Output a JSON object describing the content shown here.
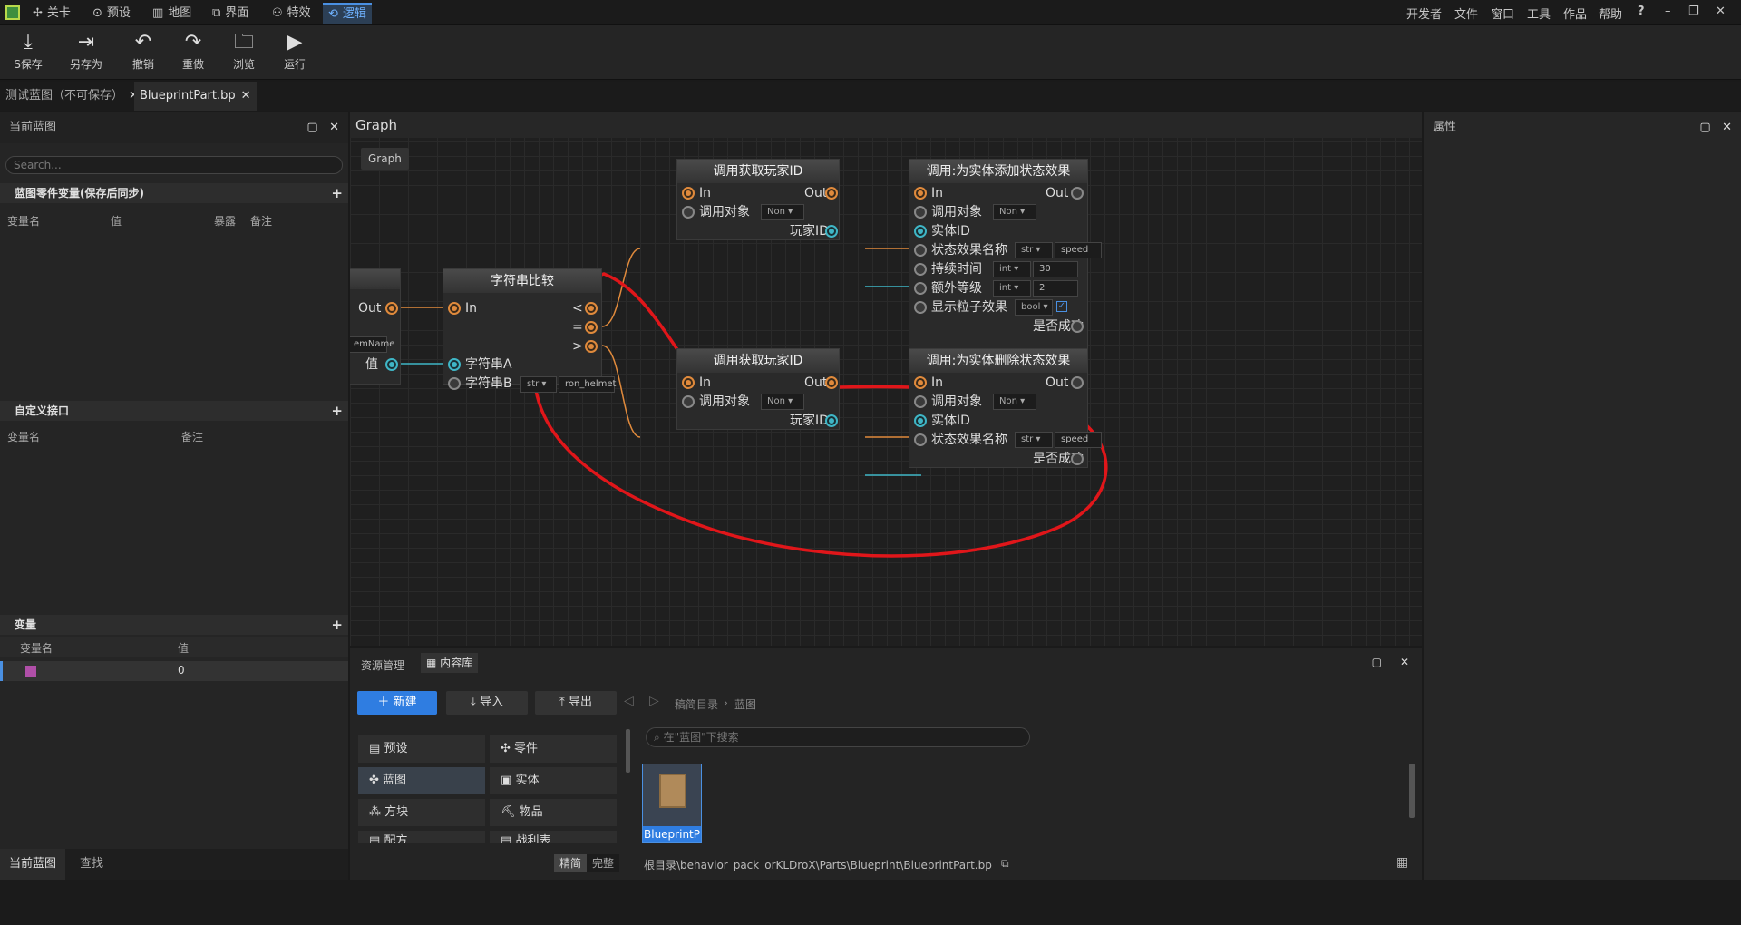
{
  "menu": {
    "tabs": [
      "关卡",
      "预设",
      "地图",
      "界面",
      "特效",
      "逻辑"
    ],
    "right": [
      "开发者",
      "文件",
      "窗口",
      "工具",
      "作品",
      "帮助",
      "?"
    ]
  },
  "toolbar": {
    "save": "S保存",
    "saveas": "另存为",
    "undo": "撤销",
    "redo": "重做",
    "browse": "浏览",
    "run": "运行"
  },
  "doc_tabs": [
    "测试蓝图（不可保存）",
    "BlueprintPart.bp"
  ],
  "left": {
    "title": "当前蓝图",
    "search_placeholder": "Search...",
    "sec1": "蓝图零件变量(保存后同步)",
    "sec1_cols": [
      "变量名",
      "值",
      "暴露",
      "备注"
    ],
    "sec2": "自定义接口",
    "sec2_cols": [
      "变量名",
      "备注"
    ],
    "sec3": "变量",
    "sec3_cols": [
      "变量名",
      "值"
    ],
    "var_value": "0",
    "bottom_tabs": [
      "当前蓝图",
      "查找"
    ]
  },
  "graph": {
    "title": "Graph",
    "crumb": "Graph",
    "partial": {
      "out": "Out",
      "field": "emName",
      "val": "值"
    },
    "cmp": {
      "title": "字符串比较",
      "in": "In",
      "lt": "<",
      "eq": "=",
      "gt": ">",
      "a": "字符串A",
      "b": "字符串B",
      "type": "str",
      "value": "ron_helmet"
    },
    "get1": {
      "title": "调用获取玩家ID",
      "in": "In",
      "out": "Out",
      "target": "调用对象",
      "dd": "Non",
      "pid": "玩家ID"
    },
    "add": {
      "title": "调用:为实体添加状态效果",
      "in": "In",
      "out": "Out",
      "target": "调用对象",
      "dd": "Non",
      "eid": "实体ID",
      "name": "状态效果名称",
      "name_t": "str",
      "name_v": "speed",
      "dur": "持续时间",
      "dur_t": "int",
      "dur_v": "30",
      "lvl": "额外等级",
      "lvl_t": "int",
      "lvl_v": "2",
      "part": "显示粒子效果",
      "part_t": "bool",
      "ok": "是否成功"
    },
    "get2": {
      "title": "调用获取玩家ID",
      "in": "In",
      "out": "Out",
      "target": "调用对象",
      "dd": "Non",
      "pid": "玩家ID"
    },
    "del": {
      "title": "调用:为实体删除状态效果",
      "in": "In",
      "out": "Out",
      "target": "调用对象",
      "dd": "Non",
      "eid": "实体ID",
      "name": "状态效果名称",
      "name_t": "str",
      "name_v": "speed",
      "ok": "是否成功"
    }
  },
  "right": {
    "title": "属性"
  },
  "assets": {
    "tab1": "资源管理",
    "tab2": "内容库",
    "new": "新建",
    "import": "导入",
    "export": "导出",
    "path_root": "稿简目录",
    "path_cur": "蓝图",
    "search_placeholder": "在\"蓝图\"下搜索",
    "cats": [
      "预设",
      "零件",
      "蓝图",
      "实体",
      "方块",
      "物品",
      "配方",
      "战利表"
    ],
    "file": "BlueprintP",
    "mode1": "精简",
    "mode2": "完整",
    "fullpath": "根目录\\behavior_pack_orKLDroX\\Parts\\Blueprint\\BlueprintPart.bp"
  }
}
